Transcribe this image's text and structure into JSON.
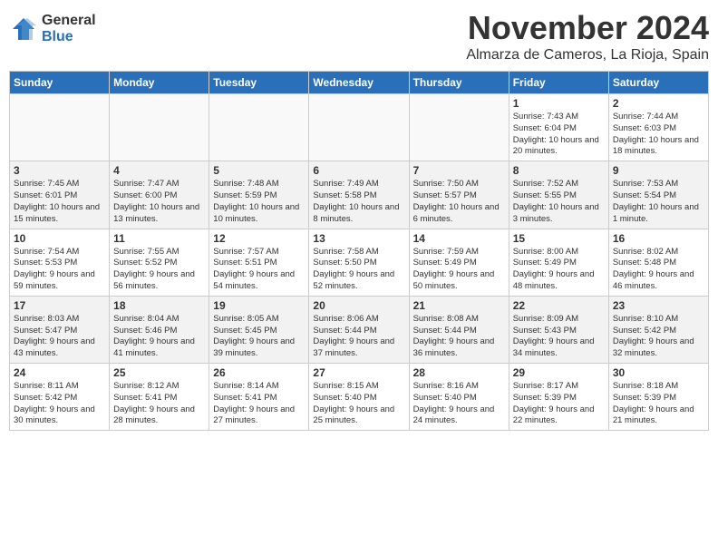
{
  "header": {
    "logo_general": "General",
    "logo_blue": "Blue",
    "month": "November 2024",
    "location": "Almarza de Cameros, La Rioja, Spain"
  },
  "weekdays": [
    "Sunday",
    "Monday",
    "Tuesday",
    "Wednesday",
    "Thursday",
    "Friday",
    "Saturday"
  ],
  "weeks": [
    [
      {
        "day": "",
        "info": ""
      },
      {
        "day": "",
        "info": ""
      },
      {
        "day": "",
        "info": ""
      },
      {
        "day": "",
        "info": ""
      },
      {
        "day": "",
        "info": ""
      },
      {
        "day": "1",
        "info": "Sunrise: 7:43 AM\nSunset: 6:04 PM\nDaylight: 10 hours and 20 minutes."
      },
      {
        "day": "2",
        "info": "Sunrise: 7:44 AM\nSunset: 6:03 PM\nDaylight: 10 hours and 18 minutes."
      }
    ],
    [
      {
        "day": "3",
        "info": "Sunrise: 7:45 AM\nSunset: 6:01 PM\nDaylight: 10 hours and 15 minutes."
      },
      {
        "day": "4",
        "info": "Sunrise: 7:47 AM\nSunset: 6:00 PM\nDaylight: 10 hours and 13 minutes."
      },
      {
        "day": "5",
        "info": "Sunrise: 7:48 AM\nSunset: 5:59 PM\nDaylight: 10 hours and 10 minutes."
      },
      {
        "day": "6",
        "info": "Sunrise: 7:49 AM\nSunset: 5:58 PM\nDaylight: 10 hours and 8 minutes."
      },
      {
        "day": "7",
        "info": "Sunrise: 7:50 AM\nSunset: 5:57 PM\nDaylight: 10 hours and 6 minutes."
      },
      {
        "day": "8",
        "info": "Sunrise: 7:52 AM\nSunset: 5:55 PM\nDaylight: 10 hours and 3 minutes."
      },
      {
        "day": "9",
        "info": "Sunrise: 7:53 AM\nSunset: 5:54 PM\nDaylight: 10 hours and 1 minute."
      }
    ],
    [
      {
        "day": "10",
        "info": "Sunrise: 7:54 AM\nSunset: 5:53 PM\nDaylight: 9 hours and 59 minutes."
      },
      {
        "day": "11",
        "info": "Sunrise: 7:55 AM\nSunset: 5:52 PM\nDaylight: 9 hours and 56 minutes."
      },
      {
        "day": "12",
        "info": "Sunrise: 7:57 AM\nSunset: 5:51 PM\nDaylight: 9 hours and 54 minutes."
      },
      {
        "day": "13",
        "info": "Sunrise: 7:58 AM\nSunset: 5:50 PM\nDaylight: 9 hours and 52 minutes."
      },
      {
        "day": "14",
        "info": "Sunrise: 7:59 AM\nSunset: 5:49 PM\nDaylight: 9 hours and 50 minutes."
      },
      {
        "day": "15",
        "info": "Sunrise: 8:00 AM\nSunset: 5:49 PM\nDaylight: 9 hours and 48 minutes."
      },
      {
        "day": "16",
        "info": "Sunrise: 8:02 AM\nSunset: 5:48 PM\nDaylight: 9 hours and 46 minutes."
      }
    ],
    [
      {
        "day": "17",
        "info": "Sunrise: 8:03 AM\nSunset: 5:47 PM\nDaylight: 9 hours and 43 minutes."
      },
      {
        "day": "18",
        "info": "Sunrise: 8:04 AM\nSunset: 5:46 PM\nDaylight: 9 hours and 41 minutes."
      },
      {
        "day": "19",
        "info": "Sunrise: 8:05 AM\nSunset: 5:45 PM\nDaylight: 9 hours and 39 minutes."
      },
      {
        "day": "20",
        "info": "Sunrise: 8:06 AM\nSunset: 5:44 PM\nDaylight: 9 hours and 37 minutes."
      },
      {
        "day": "21",
        "info": "Sunrise: 8:08 AM\nSunset: 5:44 PM\nDaylight: 9 hours and 36 minutes."
      },
      {
        "day": "22",
        "info": "Sunrise: 8:09 AM\nSunset: 5:43 PM\nDaylight: 9 hours and 34 minutes."
      },
      {
        "day": "23",
        "info": "Sunrise: 8:10 AM\nSunset: 5:42 PM\nDaylight: 9 hours and 32 minutes."
      }
    ],
    [
      {
        "day": "24",
        "info": "Sunrise: 8:11 AM\nSunset: 5:42 PM\nDaylight: 9 hours and 30 minutes."
      },
      {
        "day": "25",
        "info": "Sunrise: 8:12 AM\nSunset: 5:41 PM\nDaylight: 9 hours and 28 minutes."
      },
      {
        "day": "26",
        "info": "Sunrise: 8:14 AM\nSunset: 5:41 PM\nDaylight: 9 hours and 27 minutes."
      },
      {
        "day": "27",
        "info": "Sunrise: 8:15 AM\nSunset: 5:40 PM\nDaylight: 9 hours and 25 minutes."
      },
      {
        "day": "28",
        "info": "Sunrise: 8:16 AM\nSunset: 5:40 PM\nDaylight: 9 hours and 24 minutes."
      },
      {
        "day": "29",
        "info": "Sunrise: 8:17 AM\nSunset: 5:39 PM\nDaylight: 9 hours and 22 minutes."
      },
      {
        "day": "30",
        "info": "Sunrise: 8:18 AM\nSunset: 5:39 PM\nDaylight: 9 hours and 21 minutes."
      }
    ]
  ]
}
